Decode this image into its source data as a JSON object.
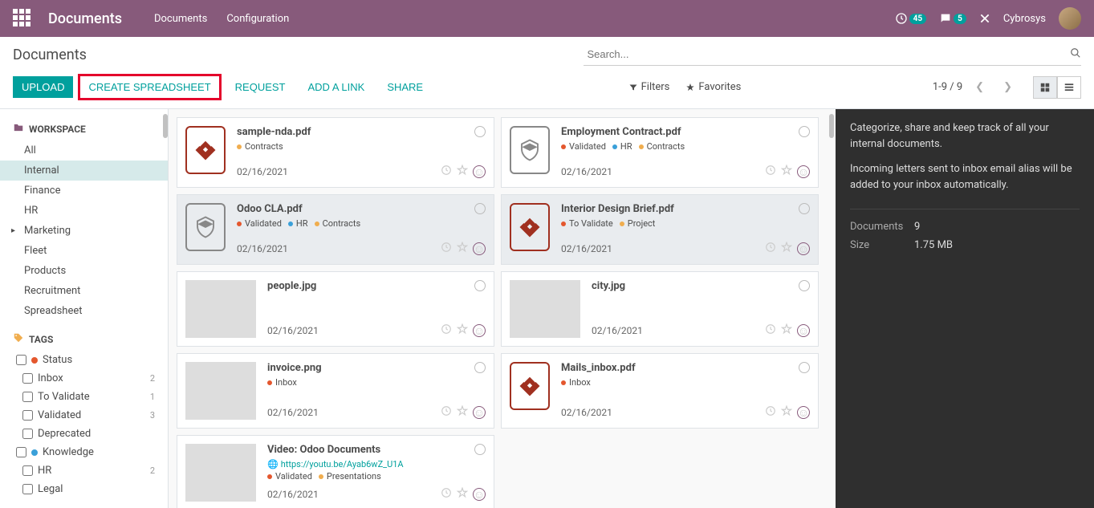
{
  "header": {
    "brand": "Documents",
    "menu": [
      "Documents",
      "Configuration"
    ],
    "activity_count": "45",
    "messages_count": "5",
    "username": "Cybrosys"
  },
  "controlpanel": {
    "title": "Documents",
    "search_placeholder": "Search...",
    "buttons": {
      "upload": "UPLOAD",
      "create_spreadsheet": "CREATE SPREADSHEET",
      "request": "REQUEST",
      "add_link": "ADD A LINK",
      "share": "SHARE"
    },
    "filters_label": "Filters",
    "favorites_label": "Favorites",
    "pager": "1-9 / 9"
  },
  "sidebar": {
    "workspace_label": "WORKSPACE",
    "workspaces": [
      {
        "label": "All",
        "active": false
      },
      {
        "label": "Internal",
        "active": true
      },
      {
        "label": "Finance",
        "active": false
      },
      {
        "label": "HR",
        "active": false
      },
      {
        "label": "Marketing",
        "active": false,
        "caret": true
      },
      {
        "label": "Fleet",
        "active": false
      },
      {
        "label": "Products",
        "active": false
      },
      {
        "label": "Recruitment",
        "active": false
      },
      {
        "label": "Spreadsheet",
        "active": false
      }
    ],
    "tags_label": "TAGS",
    "tag_groups": [
      {
        "label": "Status",
        "dot": "#e4572e",
        "items": [
          {
            "label": "Inbox",
            "count": "2"
          },
          {
            "label": "To Validate",
            "count": "1"
          },
          {
            "label": "Validated",
            "count": "3"
          },
          {
            "label": "Deprecated",
            "count": ""
          }
        ]
      },
      {
        "label": "Knowledge",
        "dot": "#3aa0d9",
        "items": [
          {
            "label": "HR",
            "count": "2"
          },
          {
            "label": "Legal",
            "count": ""
          }
        ]
      }
    ]
  },
  "documents": [
    {
      "title": "sample-nda.pdf",
      "thumb": "pdf",
      "tags": [
        {
          "dot": "#f0ad4e",
          "label": "Contracts"
        }
      ],
      "date": "02/16/2021",
      "selected": false
    },
    {
      "title": "Employment Contract.pdf",
      "thumb": "binary",
      "tags": [
        {
          "dot": "#e4572e",
          "label": "Validated"
        },
        {
          "dot": "#3aa0d9",
          "label": "HR"
        },
        {
          "dot": "#f0ad4e",
          "label": "Contracts"
        }
      ],
      "date": "02/16/2021",
      "selected": false
    },
    {
      "title": "Odoo CLA.pdf",
      "thumb": "binary",
      "tags": [
        {
          "dot": "#e4572e",
          "label": "Validated"
        },
        {
          "dot": "#3aa0d9",
          "label": "HR"
        },
        {
          "dot": "#f0ad4e",
          "label": "Contracts"
        }
      ],
      "date": "02/16/2021",
      "selected": true
    },
    {
      "title": "Interior Design Brief.pdf",
      "thumb": "pdf",
      "tags": [
        {
          "dot": "#e4572e",
          "label": "To Validate"
        },
        {
          "dot": "#f0ad4e",
          "label": "Project"
        }
      ],
      "date": "02/16/2021",
      "selected": true
    },
    {
      "title": "people.jpg",
      "thumb": "img1",
      "tags": [],
      "date": "02/16/2021",
      "selected": false
    },
    {
      "title": "city.jpg",
      "thumb": "img2",
      "tags": [],
      "date": "02/16/2021",
      "selected": false
    },
    {
      "title": "invoice.png",
      "thumb": "invoice",
      "tags": [
        {
          "dot": "#e4572e",
          "label": "Inbox"
        }
      ],
      "date": "02/16/2021",
      "selected": false
    },
    {
      "title": "Mails_inbox.pdf",
      "thumb": "pdf",
      "tags": [
        {
          "dot": "#e4572e",
          "label": "Inbox"
        }
      ],
      "date": "02/16/2021",
      "selected": false
    },
    {
      "title": "Video: Odoo Documents",
      "thumb": "video",
      "url": "https://youtu.be/Ayab6wZ_U1A",
      "tags": [
        {
          "dot": "#e4572e",
          "label": "Validated"
        },
        {
          "dot": "#f0ad4e",
          "label": "Presentations"
        }
      ],
      "date": "02/16/2021",
      "selected": false
    }
  ],
  "infopanel": {
    "desc1": "Categorize, share and keep track of all your internal documents.",
    "desc2": "Incoming letters sent to inbox email alias will be added to your inbox automatically.",
    "stats": {
      "documents_label": "Documents",
      "documents_value": "9",
      "size_label": "Size",
      "size_value": "1.75 MB"
    }
  },
  "colors": {
    "primary": "#875a7b",
    "teal": "#00a09d"
  }
}
